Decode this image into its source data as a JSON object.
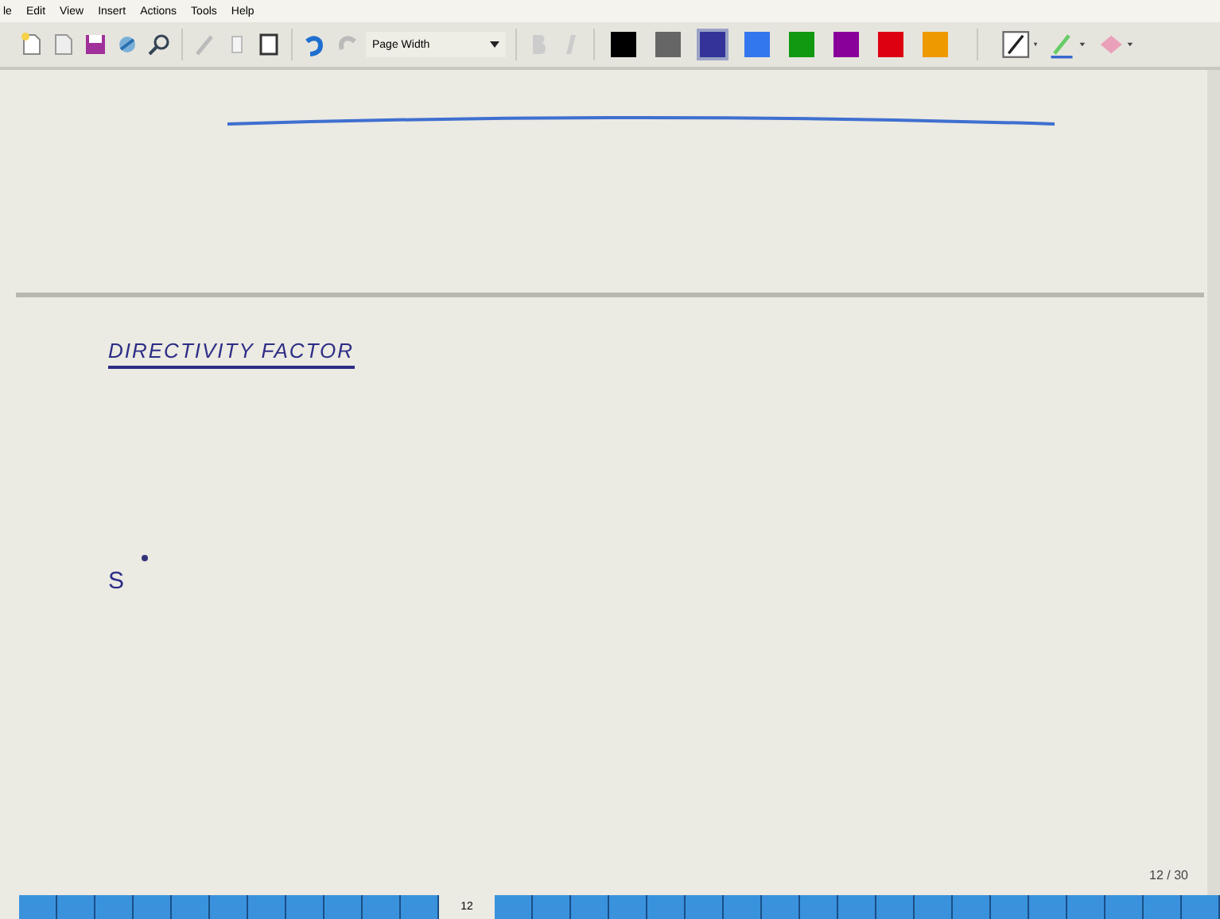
{
  "menu": [
    "le",
    "Edit",
    "View",
    "Insert",
    "Actions",
    "Tools",
    "Help"
  ],
  "toolbar": {
    "zoom": "Page Width",
    "colors": [
      {
        "color": "#000000",
        "selected": false
      },
      {
        "color": "#666666",
        "selected": false
      },
      {
        "color": "#333399",
        "selected": true
      },
      {
        "color": "#3377ee",
        "selected": false
      },
      {
        "color": "#119911",
        "selected": false
      },
      {
        "color": "#880099",
        "selected": false
      },
      {
        "color": "#dd0011",
        "selected": false
      },
      {
        "color": "#ee9900",
        "selected": false
      }
    ]
  },
  "page": {
    "heading": "DIRECTIVITY FACTOR",
    "label": "S",
    "page_indicator": "12 / 30"
  },
  "page_tabs": {
    "current": "12"
  }
}
